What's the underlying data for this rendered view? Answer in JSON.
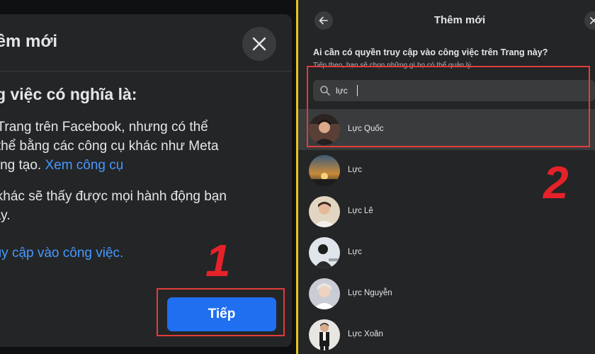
{
  "left_dialog": {
    "title": "hêm mới",
    "heading": "ng việc có nghĩa là:",
    "para1_line1": "g Trang trên Facebook, nhưng có thể",
    "para1_line2": "ụ thể bằng các công cụ khác như Meta",
    "para1_line3_text": "sáng tạo. ",
    "para1_line3_link": "Xem công cụ",
    "para2_line1": "ý khác sẽ thấy được mọi hành động bạn",
    "para2_line2": "này.",
    "link_access": "truy cập vào công việc.",
    "next_button": "Tiếp",
    "close_icon": "close-icon"
  },
  "annotations": {
    "step_1": "1",
    "step_2": "2",
    "highlight_color": "#e23c3c"
  },
  "right_dialog": {
    "title": "Thêm mới",
    "question": "Ai cần có quyền truy cập vào công việc trên Trang này?",
    "subtext": "Tiếp theo, bạn sẽ chọn những gì họ có thể quản lý.",
    "search": {
      "value": "lực",
      "icon": "search-icon"
    },
    "results": [
      {
        "name": "Lực Quốc",
        "selected": true
      },
      {
        "name": "Lực",
        "selected": false
      },
      {
        "name": "Lực Lê",
        "selected": false
      },
      {
        "name": "Lực",
        "selected": false
      },
      {
        "name": "Lực Nguyễn",
        "selected": false
      },
      {
        "name": "Lực Xoăn",
        "selected": false
      }
    ]
  },
  "colors": {
    "panel_bg": "#242526",
    "button_blue": "#1f6ff0",
    "link_blue": "#4599ff",
    "divider_yellow": "#e8c51a"
  }
}
